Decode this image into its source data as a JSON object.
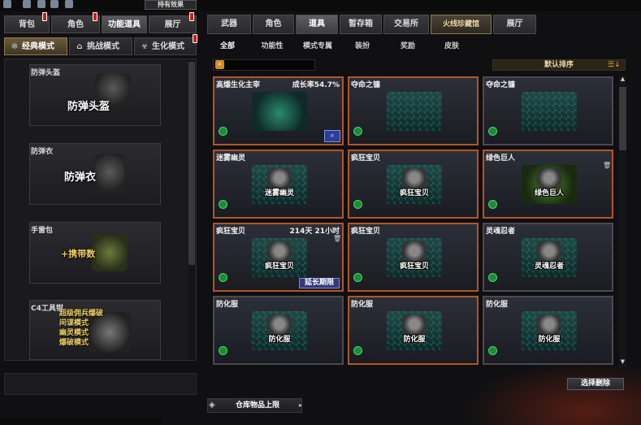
{
  "top_bar": {
    "apply_effect_label": "持有效果"
  },
  "left_tabs": [
    {
      "label": "背包",
      "active": false
    },
    {
      "label": "角色",
      "active": false
    },
    {
      "label": "功能道具",
      "active": true
    },
    {
      "label": "展厅",
      "active": false
    }
  ],
  "mode_tabs": [
    {
      "label": "经典模式",
      "icon": "classic-mode-icon",
      "active": true
    },
    {
      "label": "挑战模式",
      "icon": "challenge-mode-icon",
      "active": false
    },
    {
      "label": "生化模式",
      "icon": "biohazard-mode-icon",
      "active": false
    }
  ],
  "equip_slots": [
    {
      "title": "防弹头盔",
      "name": "防弹头盔"
    },
    {
      "title": "防弹衣",
      "name": "防弹衣"
    },
    {
      "title": "手雷包",
      "name": "+携带数"
    },
    {
      "title": "C4工具钳",
      "lines": [
        "超级佣兵爆破",
        "间谍模式",
        "幽灵模式",
        "爆破模式"
      ]
    }
  ],
  "right_tabs": [
    {
      "label": "武器",
      "active": false
    },
    {
      "label": "角色",
      "active": false
    },
    {
      "label": "道具",
      "active": true
    },
    {
      "label": "暂存箱",
      "active": false
    },
    {
      "label": "交易所",
      "active": false
    },
    {
      "label": "火线珍藏馆",
      "active": false,
      "special": true
    },
    {
      "label": "展厅",
      "active": false
    }
  ],
  "sub_tabs": [
    {
      "label": "全部",
      "active": true
    },
    {
      "label": "功能性",
      "active": false
    },
    {
      "label": "模式专属",
      "active": false
    },
    {
      "label": "装扮",
      "active": false
    },
    {
      "label": "奖励",
      "active": false
    },
    {
      "label": "皮肤",
      "active": false
    }
  ],
  "search": {
    "placeholder": "",
    "value": ""
  },
  "sort": {
    "label": "默认排序"
  },
  "inventory": [
    {
      "name": "高爆生化主宰",
      "extra": "成长率54.7%",
      "art_label": "",
      "highlight": true,
      "magnify": true
    },
    {
      "name": "夺命之镰",
      "extra": "",
      "art_label": "",
      "highlight": true
    },
    {
      "name": "夺命之镰",
      "extra": "",
      "art_label": "",
      "highlight": false
    },
    {
      "name": "迷雾幽灵",
      "extra": "",
      "art_label": "迷雾幽灵",
      "highlight": true
    },
    {
      "name": "疯狂宝贝",
      "extra": "",
      "art_label": "疯狂宝贝",
      "highlight": true
    },
    {
      "name": "绿色巨人",
      "extra": "",
      "art_label": "绿色巨人",
      "highlight": true,
      "trash": true
    },
    {
      "name": "疯狂宝贝",
      "extra": "214天 21小时",
      "art_label": "疯狂宝贝",
      "highlight": true,
      "trash": true,
      "extend_label": "延长期限"
    },
    {
      "name": "疯狂宝贝",
      "extra": "",
      "art_label": "疯狂宝贝",
      "highlight": true
    },
    {
      "name": "灵魂忍者",
      "extra": "",
      "art_label": "灵魂忍者",
      "highlight": false
    },
    {
      "name": "防化服",
      "extra": "",
      "art_label": "防化服",
      "highlight": false
    },
    {
      "name": "防化服",
      "extra": "",
      "art_label": "防化服",
      "highlight": true
    },
    {
      "name": "防化服",
      "extra": "",
      "art_label": "防化服",
      "highlight": false
    }
  ],
  "footer": {
    "select_delete_label": "选择删除",
    "storage_label": "仓库物品上限"
  }
}
